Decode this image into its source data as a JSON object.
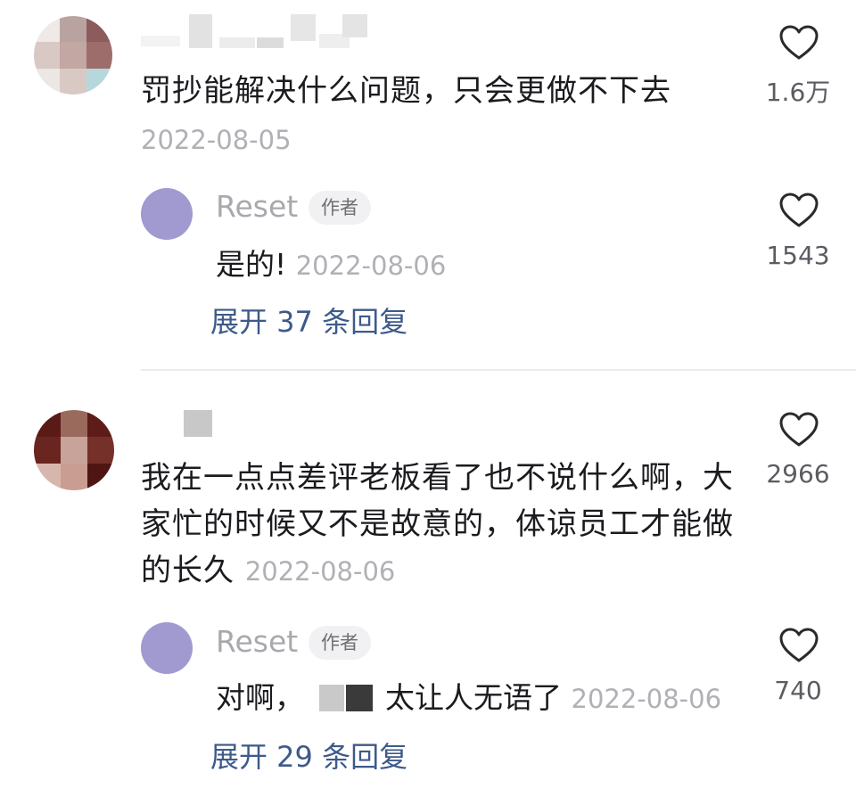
{
  "comments": [
    {
      "avatar_icon": "blurred-avatar",
      "text": "罚抄能解决什么问题，只会更做不下去",
      "date": "2022-08-05",
      "likes": "1.6万",
      "reply": {
        "name": "Reset",
        "badge": "作者",
        "text": "是的!",
        "date": "2022-08-06",
        "likes": "1543"
      },
      "expand_label": "展开 37 条回复"
    },
    {
      "avatar_icon": "blurred-avatar",
      "text_lines": [
        "我在一点点差评老板看了也不说什么啊，大",
        "家忙的时候又不是故意的，体谅员工才能做",
        "的长久"
      ],
      "date": "2022-08-06",
      "likes": "2966",
      "reply": {
        "name": "Reset",
        "badge": "作者",
        "text_prefix": "对啊，",
        "text_suffix": "太让人无语了",
        "date": "2022-08-06",
        "likes": "740"
      },
      "expand_label": "展开 29 条回复"
    }
  ],
  "icons": {
    "like": "heart-outline-icon"
  },
  "colors": {
    "text": "#1b1b1f",
    "muted": "#b0b0b6",
    "link": "#3d5a8a",
    "reply_avatar": "#a09ad0"
  }
}
